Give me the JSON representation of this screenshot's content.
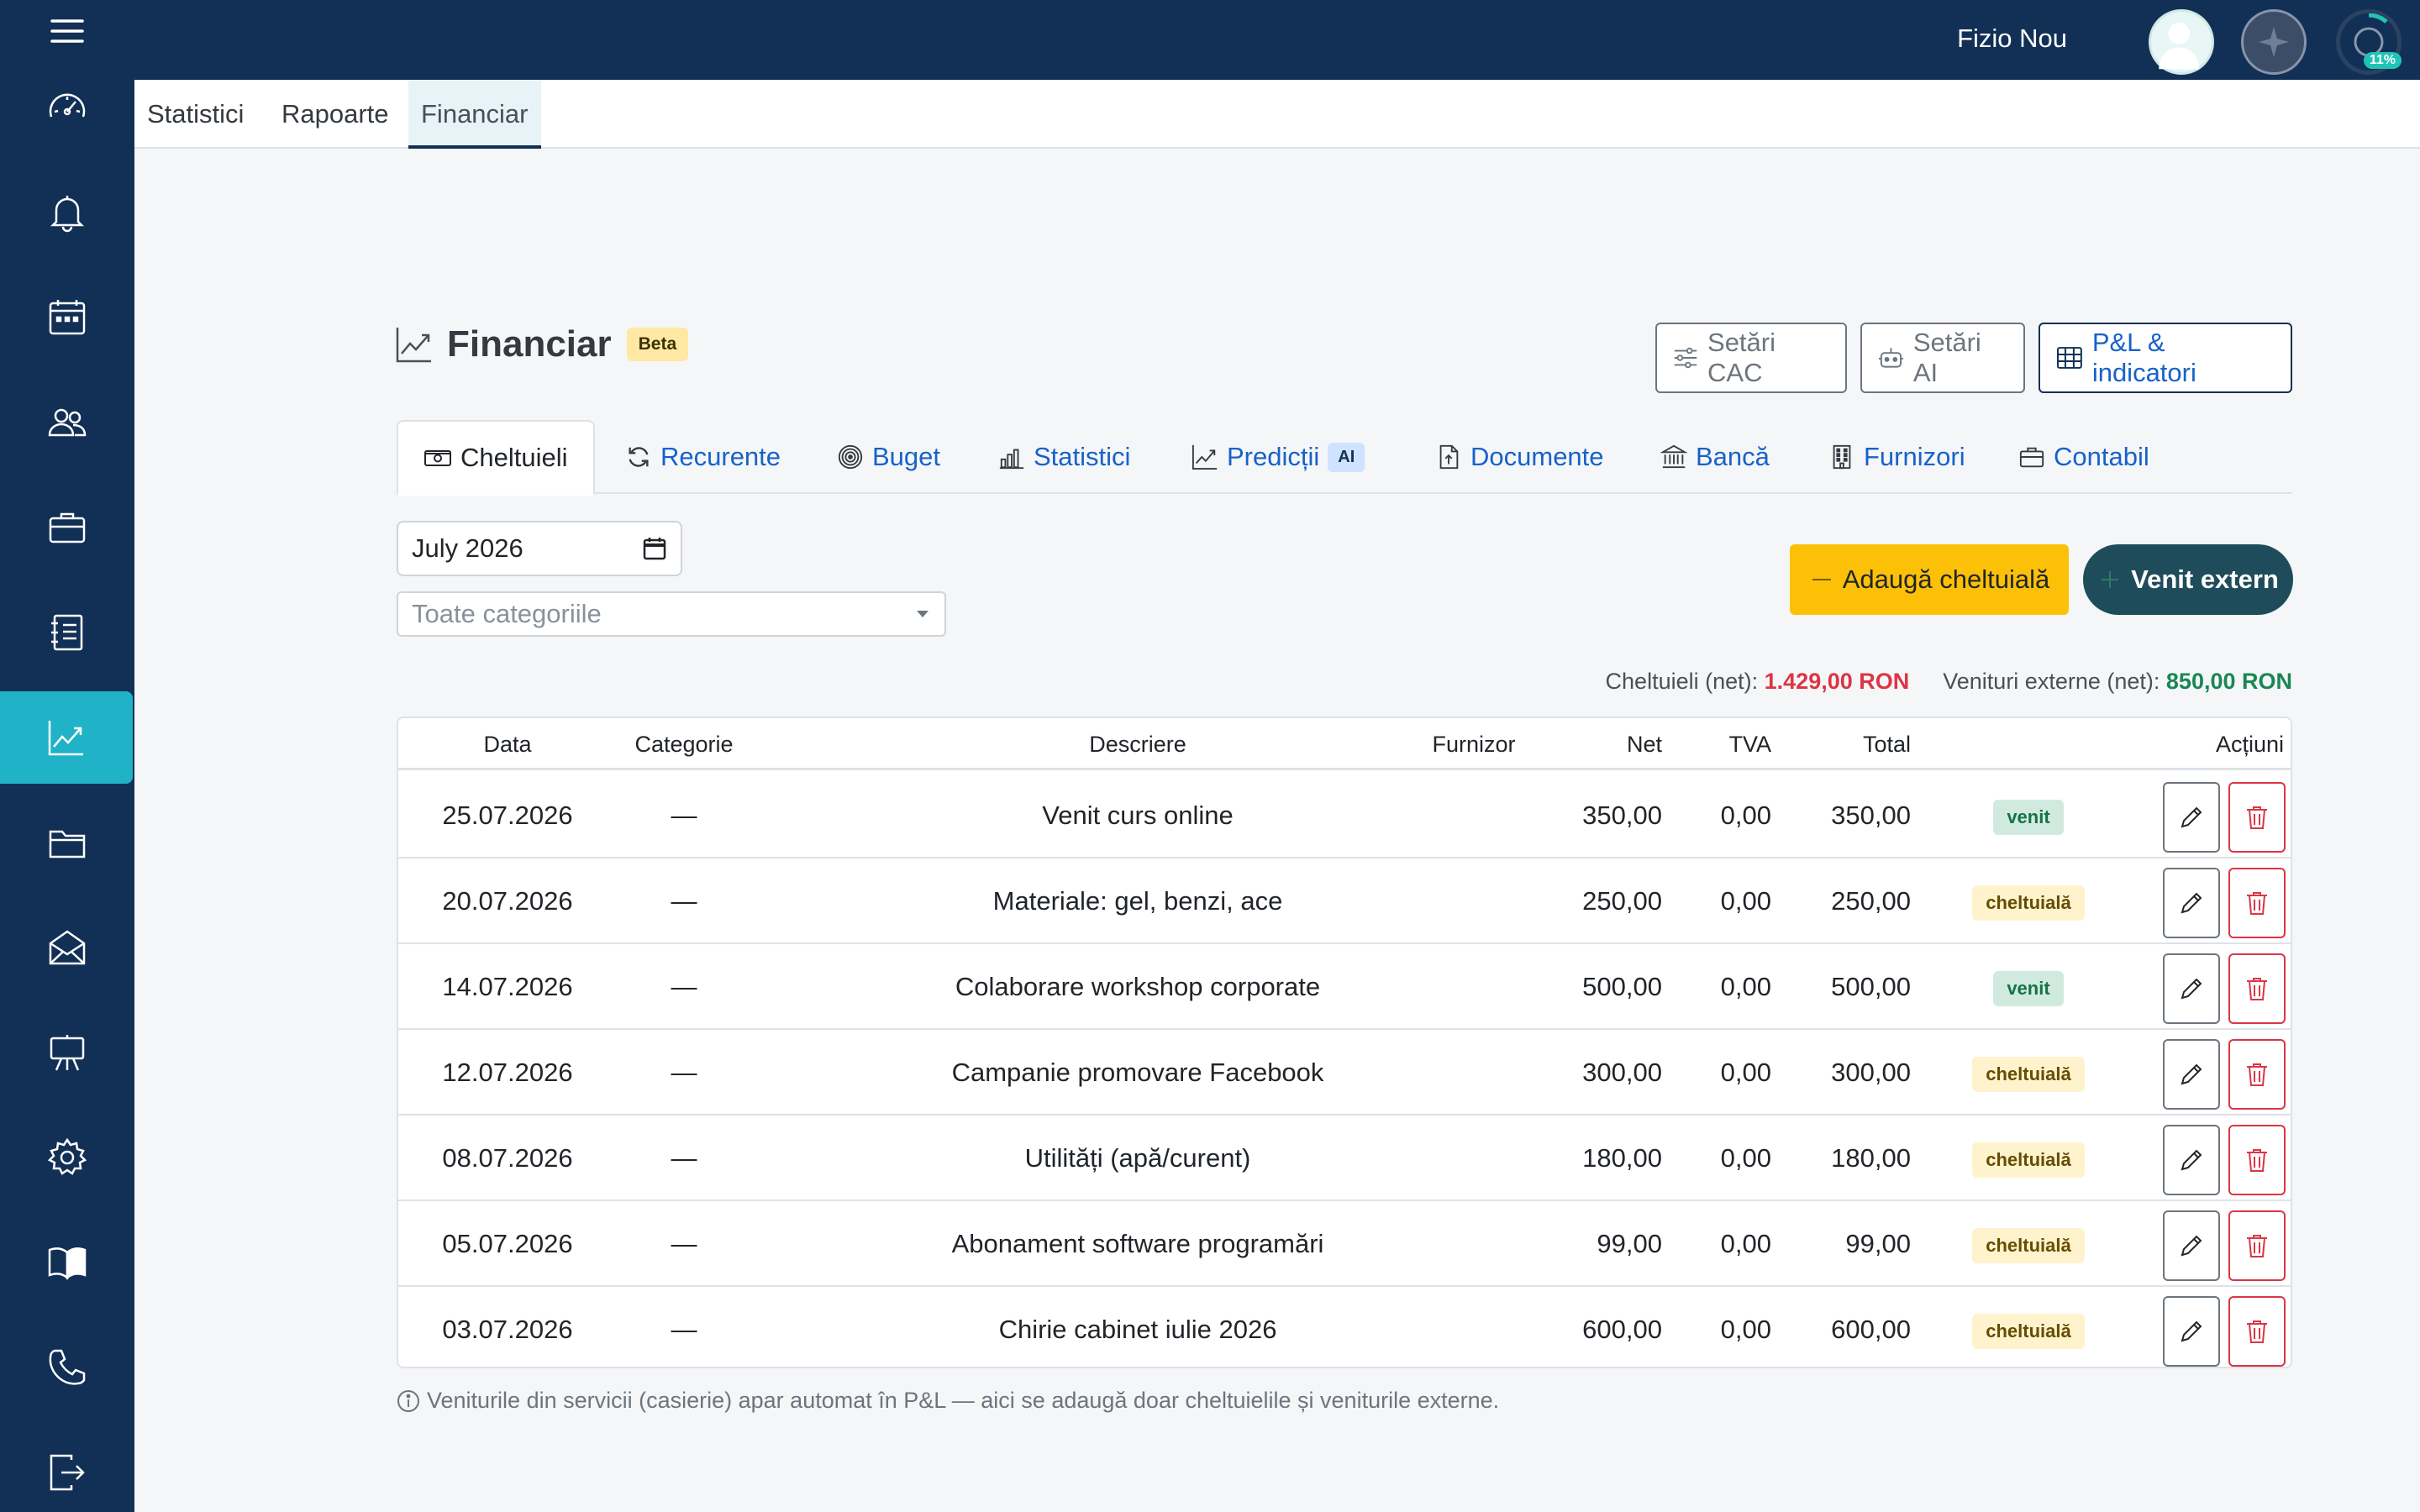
{
  "topbar": {
    "user_name": "Fizio Nou",
    "progress_badge": "11%",
    "progress_percent": 11
  },
  "subnav": {
    "tabs": [
      "Statistici",
      "Rapoarte",
      "Financiar"
    ],
    "active": 2
  },
  "sidebar": {
    "icons": [
      "speedometer-icon",
      "bell-icon",
      "calendar-icon",
      "people-icon",
      "briefcase-icon",
      "journal-icon",
      "graph-icon",
      "folder-icon",
      "envelope-icon",
      "easel-icon",
      "gear-icon",
      "book-icon",
      "phone-icon",
      "logout-icon"
    ],
    "active_index": 6
  },
  "page": {
    "title": "Financiar",
    "beta_label": "Beta"
  },
  "header_buttons": {
    "cac": "Setări CAC",
    "ai": "Setări AI",
    "pl": "P&L & indicatori"
  },
  "tabs": {
    "cheltuieli": "Cheltuieli",
    "recurente": "Recurente",
    "buget": "Buget",
    "statistici": "Statistici",
    "predictii": "Predicții",
    "predictii_badge": "AI",
    "documente": "Documente",
    "banca": "Bancă",
    "furnizori": "Furnizori",
    "contabil": "Contabil"
  },
  "filters": {
    "month_value": "July 2026",
    "category_placeholder": "Toate categoriile"
  },
  "actions": {
    "add_expense": "Adaugă cheltuială",
    "external_income": "Venit extern"
  },
  "totals": {
    "expenses_label": "Cheltuieli (net):",
    "expenses_value": "1.429,00 RON",
    "income_label": "Venituri externe (net):",
    "income_value": "850,00 RON"
  },
  "table": {
    "headers": {
      "date": "Data",
      "category": "Categorie",
      "description": "Descriere",
      "supplier": "Furnizor",
      "net": "Net",
      "vat": "TVA",
      "total": "Total",
      "actions": "Acțiuni"
    },
    "rows": [
      {
        "date": "25.07.2026",
        "category": "—",
        "description": "Venit curs online",
        "supplier": "",
        "net": "350,00",
        "vat": "0,00",
        "total": "350,00",
        "type": "venit"
      },
      {
        "date": "20.07.2026",
        "category": "—",
        "description": "Materiale: gel, benzi, ace",
        "supplier": "",
        "net": "250,00",
        "vat": "0,00",
        "total": "250,00",
        "type": "cheltuială"
      },
      {
        "date": "14.07.2026",
        "category": "—",
        "description": "Colaborare workshop corporate",
        "supplier": "",
        "net": "500,00",
        "vat": "0,00",
        "total": "500,00",
        "type": "venit"
      },
      {
        "date": "12.07.2026",
        "category": "—",
        "description": "Campanie promovare Facebook",
        "supplier": "",
        "net": "300,00",
        "vat": "0,00",
        "total": "300,00",
        "type": "cheltuială"
      },
      {
        "date": "08.07.2026",
        "category": "—",
        "description": "Utilități (apă/curent)",
        "supplier": "",
        "net": "180,00",
        "vat": "0,00",
        "total": "180,00",
        "type": "cheltuială"
      },
      {
        "date": "05.07.2026",
        "category": "—",
        "description": "Abonament software programări",
        "supplier": "",
        "net": "99,00",
        "vat": "0,00",
        "total": "99,00",
        "type": "cheltuială"
      },
      {
        "date": "03.07.2026",
        "category": "—",
        "description": "Chirie cabinet iulie 2026",
        "supplier": "",
        "net": "600,00",
        "vat": "0,00",
        "total": "600,00",
        "type": "cheltuială"
      }
    ]
  },
  "footnote": "Veniturile din servicii (casierie) apar automat în P&L — aici se adaugă doar cheltuielile și veniturile externe.",
  "colors": {
    "sidebar_bg": "#123055",
    "sidebar_active": "#20b3c7",
    "link_blue": "#1762c9",
    "warning_yellow": "#fcc107",
    "external_btn": "#1f4c5a",
    "danger": "#dc3545",
    "success": "#198754"
  }
}
